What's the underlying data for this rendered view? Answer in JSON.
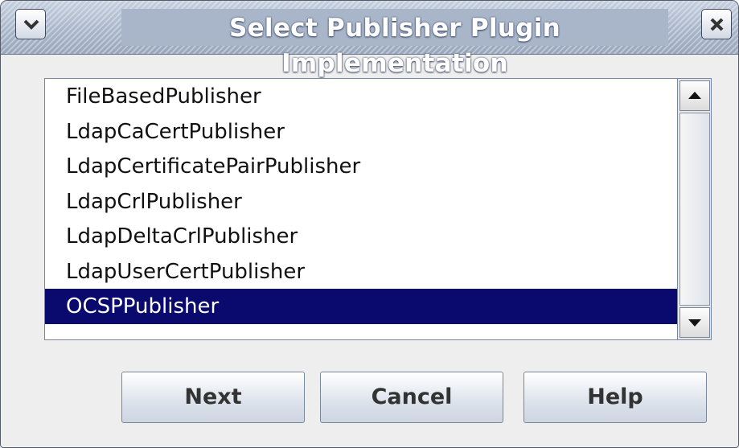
{
  "window": {
    "title": "Select Publisher Plugin Implementation"
  },
  "titlebar": {
    "menu_icon": "chevron-down-icon",
    "close_icon": "close-icon"
  },
  "list": {
    "items": [
      "FileBasedPublisher",
      "LdapCaCertPublisher",
      "LdapCertificatePairPublisher",
      "LdapCrlPublisher",
      "LdapDeltaCrlPublisher",
      "LdapUserCertPublisher",
      "OCSPPublisher"
    ],
    "selected": "OCSPPublisher"
  },
  "buttons": {
    "next": "Next",
    "cancel": "Cancel",
    "help": "Help"
  },
  "colors": {
    "selection": "#0a0a6e",
    "titlebar": "#a9b6ca"
  }
}
